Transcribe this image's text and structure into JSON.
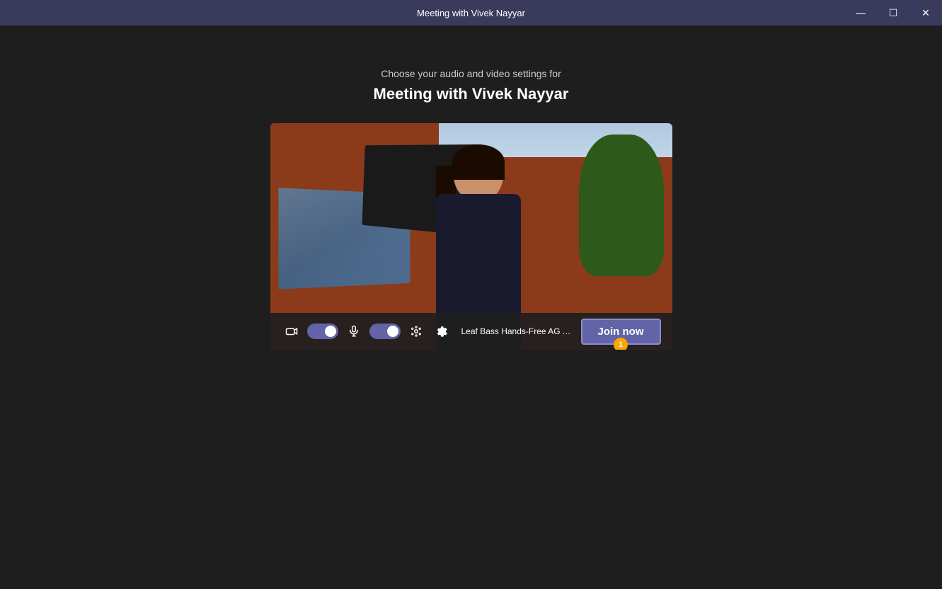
{
  "titleBar": {
    "title": "Meeting with Vivek Nayyar",
    "minimizeLabel": "minimize",
    "maximizeLabel": "maximize",
    "closeLabel": "close",
    "minimizeIcon": "—",
    "maximizeIcon": "☐",
    "closeIcon": "✕"
  },
  "header": {
    "subtitle": "Choose your audio and video settings for",
    "meetingTitle": "Meeting with Vivek Nayyar"
  },
  "controls": {
    "audioDeviceLabel": "Leaf Bass Hands-Free AG Au...",
    "joinNowLabel": "Join now",
    "notificationBadge": "1"
  },
  "colors": {
    "accent": "#6264a7",
    "accentBorder": "#8b8cc9",
    "titleBarBg": "#3a3a5c",
    "bodyBg": "#1e1e1e",
    "badgeColor": "#f8a800"
  }
}
